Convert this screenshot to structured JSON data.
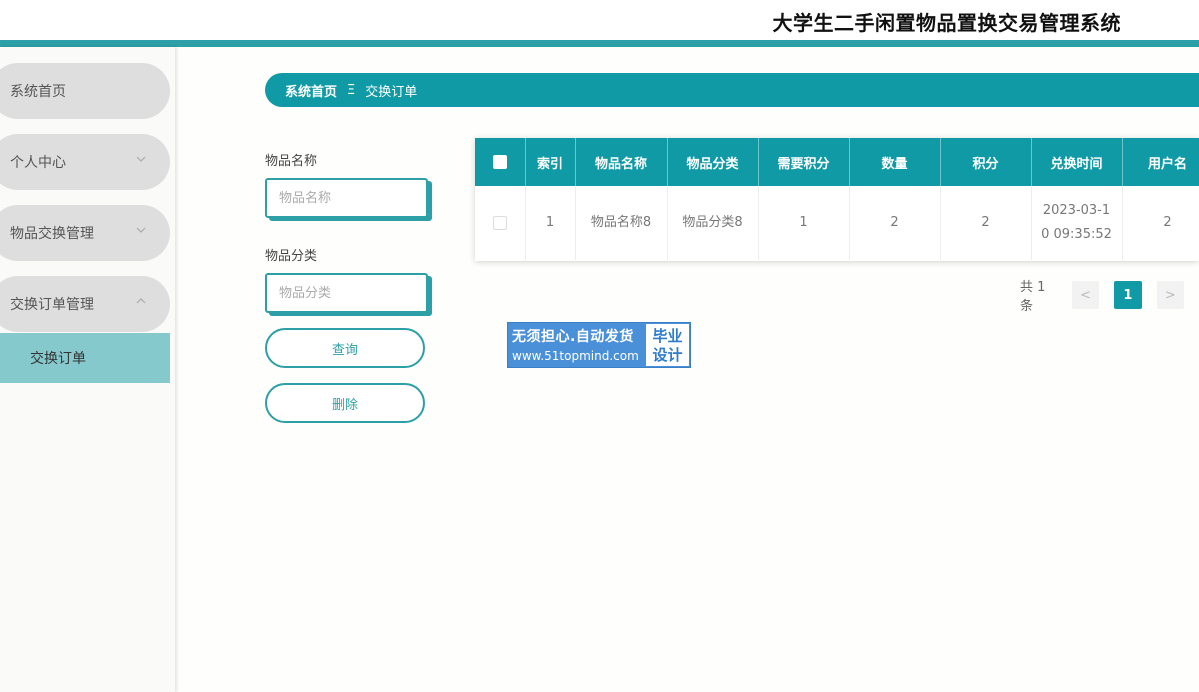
{
  "header": {
    "title": "大学生二手闲置物品置换交易管理系统",
    "accent_color": "#2d9fa6"
  },
  "sidebar": {
    "items": [
      {
        "label": "系统首页"
      },
      {
        "label": "个人中心",
        "icon": "chevron-down-icon"
      },
      {
        "label": "物品交换管理",
        "icon": "chevron-down-icon"
      },
      {
        "label": "交换订单管理",
        "icon": "chevron-up-icon"
      }
    ],
    "sub_item": {
      "label": "交换订单"
    }
  },
  "breadcrumb": {
    "home": "系统首页",
    "separator": "Ξ",
    "current": "交换订单"
  },
  "search": {
    "name_label": "物品名称",
    "name_placeholder": "物品名称",
    "category_label": "物品分类",
    "category_placeholder": "物品分类",
    "query_button": "查询",
    "delete_button": "删除"
  },
  "table": {
    "columns": [
      "索引",
      "物品名称",
      "物品分类",
      "需要积分",
      "数量",
      "积分",
      "兑换时间",
      "用户名"
    ],
    "rows": [
      [
        "1",
        "物品名称8",
        "物品分类8",
        "1",
        "2",
        "2",
        "2023-03-10 09:35:52",
        "2"
      ]
    ]
  },
  "pagination": {
    "total": "共 1 条",
    "prev": "<",
    "page": "1",
    "next": ">"
  },
  "watermark": {
    "line1": "无须担心.自动发货",
    "line2": "www.51topmind.com",
    "badge1": "毕业",
    "badge2": "设计"
  },
  "colors": {
    "primary": "#0f9aa5",
    "sidebar_active": "#86c9cd",
    "menu_bg": "#dedede"
  }
}
